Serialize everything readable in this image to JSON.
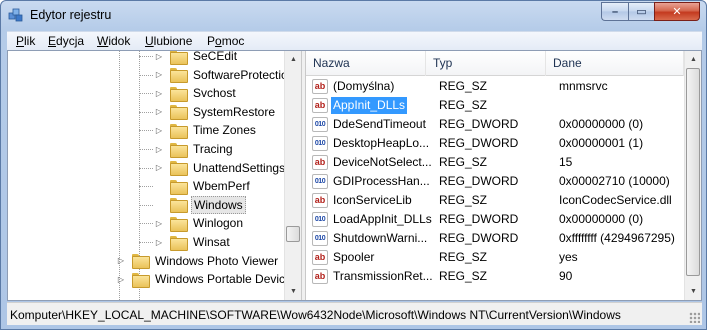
{
  "window": {
    "title": "Edytor rejestru",
    "controls": {
      "minimize": "–",
      "maximize": "▭",
      "close": "✕"
    }
  },
  "menu": [
    {
      "label": "Plik",
      "access_key": "P"
    },
    {
      "label": "Edycja",
      "access_key": "E"
    },
    {
      "label": "Widok",
      "access_key": "W"
    },
    {
      "label": "Ulubione",
      "access_key": "U"
    },
    {
      "label": "Pomoc",
      "access_key": "o"
    }
  ],
  "tree": {
    "items": [
      {
        "label": "SeCEdit",
        "expander": "▷",
        "selected": false
      },
      {
        "label": "SoftwareProtectio",
        "expander": "▷",
        "selected": false
      },
      {
        "label": "Svchost",
        "expander": "▷",
        "selected": false
      },
      {
        "label": "SystemRestore",
        "expander": "▷",
        "selected": false
      },
      {
        "label": "Time Zones",
        "expander": "▷",
        "selected": false
      },
      {
        "label": "Tracing",
        "expander": "▷",
        "selected": false
      },
      {
        "label": "UnattendSettings",
        "expander": "▷",
        "selected": false
      },
      {
        "label": "WbemPerf",
        "expander": "",
        "selected": false
      },
      {
        "label": "Windows",
        "expander": "",
        "selected": true
      },
      {
        "label": "Winlogon",
        "expander": "▷",
        "selected": false
      },
      {
        "label": "Winsat",
        "expander": "▷",
        "selected": false
      },
      {
        "label": "Windows Photo Viewer",
        "expander": "▷",
        "selected": false
      },
      {
        "label": "Windows Portable Device",
        "expander": "▷",
        "selected": false
      }
    ]
  },
  "list": {
    "columns": {
      "name": "Nazwa",
      "type": "Typ",
      "data": "Dane"
    },
    "rows": [
      {
        "icon": "ab",
        "name": "(Domyślna)",
        "type": "REG_SZ",
        "data": "mnmsrvc",
        "selected": false
      },
      {
        "icon": "ab",
        "name": "AppInit_DLLs",
        "type": "REG_SZ",
        "data": "",
        "selected": true
      },
      {
        "icon": "010",
        "name": "DdeSendTimeout",
        "type": "REG_DWORD",
        "data": "0x00000000 (0)",
        "selected": false
      },
      {
        "icon": "010",
        "name": "DesktopHeapLo...",
        "type": "REG_DWORD",
        "data": "0x00000001 (1)",
        "selected": false
      },
      {
        "icon": "ab",
        "name": "DeviceNotSelect...",
        "type": "REG_SZ",
        "data": "15",
        "selected": false
      },
      {
        "icon": "010",
        "name": "GDIProcessHan...",
        "type": "REG_DWORD",
        "data": "0x00002710 (10000)",
        "selected": false
      },
      {
        "icon": "ab",
        "name": "IconServiceLib",
        "type": "REG_SZ",
        "data": "IconCodecService.dll",
        "selected": false
      },
      {
        "icon": "010",
        "name": "LoadAppInit_DLLs",
        "type": "REG_DWORD",
        "data": "0x00000000 (0)",
        "selected": false
      },
      {
        "icon": "010",
        "name": "ShutdownWarni...",
        "type": "REG_DWORD",
        "data": "0xffffffff (4294967295)",
        "selected": false
      },
      {
        "icon": "ab",
        "name": "Spooler",
        "type": "REG_SZ",
        "data": "yes",
        "selected": false
      },
      {
        "icon": "ab",
        "name": "TransmissionRet...",
        "type": "REG_SZ",
        "data": "90",
        "selected": false
      }
    ]
  },
  "statusbar": {
    "path": "Komputer\\HKEY_LOCAL_MACHINE\\SOFTWARE\\Wow6432Node\\Microsoft\\Windows NT\\CurrentVersion\\Windows"
  },
  "colors": {
    "selection": "#3399ff",
    "title_gradient": "#b4cbe8",
    "close_button": "#c43a1f",
    "string_icon": "#b2201a",
    "dword_icon": "#1d48a7"
  }
}
